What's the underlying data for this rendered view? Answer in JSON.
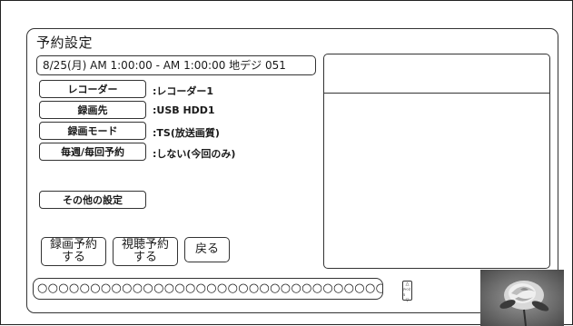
{
  "panel": {
    "title": "予約設定",
    "info_line": "8/25(月) AM 1:00:00 - AM 1:00:00  地デジ 051"
  },
  "settings": [
    {
      "label": "レコーダー",
      "value": ":レコーダー1"
    },
    {
      "label": "録画先",
      "value": ":USB HDD1"
    },
    {
      "label": "録画モード",
      "value": ":TS(放送画質)"
    },
    {
      "label": "毎週/毎回予約",
      "value": ":しない(今回のみ)"
    }
  ],
  "other_settings_label": "その他の設定",
  "actions": {
    "record_reserve": [
      "録画予約",
      "する"
    ],
    "watch_reserve": [
      "視聴予約",
      "する"
    ],
    "back": "戻る"
  },
  "ticker_text": "○○○○○○○○○○○○○○○○○○○○○○○○○○○○○○○○○",
  "channel_control": {
    "up": "△",
    "label": "ﾁｬﾝﾈﾙ",
    "down": "▽"
  },
  "thumbnail": {
    "icon": "rose-image"
  }
}
